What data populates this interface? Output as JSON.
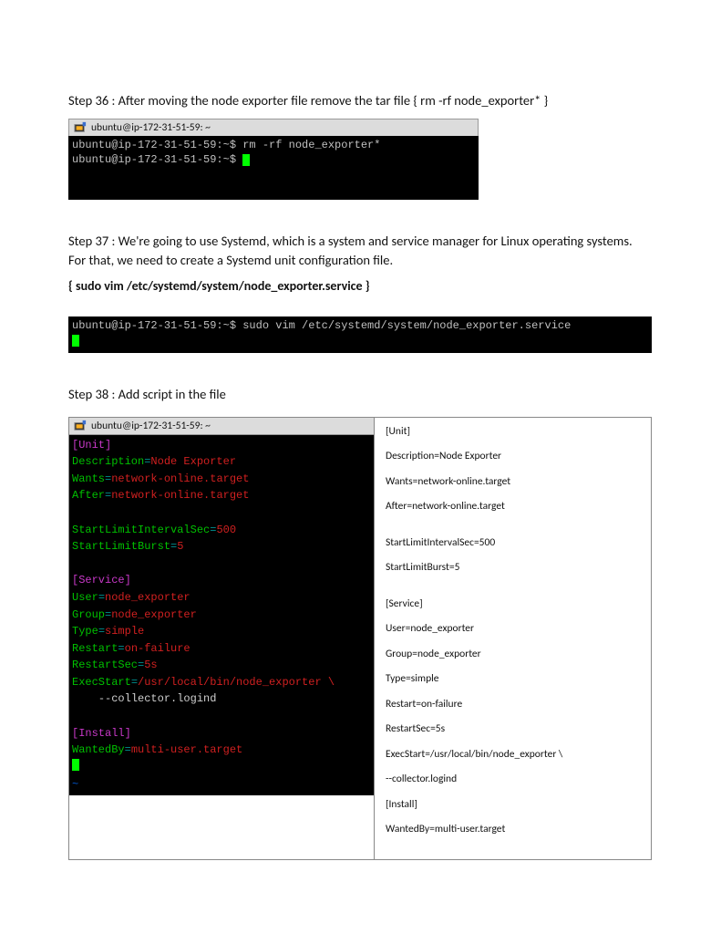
{
  "step36": {
    "heading": "Step 36 : After moving the node exporter file remove the tar file { rm -rf node_exporter* }",
    "titlebar": "ubuntu@ip-172-31-51-59: ~",
    "line1_prompt": "ubuntu@ip-172-31-51-59:~$",
    "line1_cmd": " rm -rf node_exporter*",
    "line2_prompt": "ubuntu@ip-172-31-51-59:~$ "
  },
  "step37": {
    "heading": "Step 37 : We're going to use Systemd, which is a system and service manager for Linux operating systems. For that, we need to create a Systemd unit configuration file.",
    "cmd_bold": "{ sudo vim /etc/systemd/system/node_exporter.service }",
    "term_prompt": "ubuntu@ip-172-31-51-59:~$",
    "term_cmd": " sudo vim /etc/systemd/system/node_exporter.service"
  },
  "step38": {
    "heading": "Step 38 : Add script in the file",
    "titlebar": "ubuntu@ip-172-31-51-59: ~",
    "vim": {
      "unit_hdr": "[Unit]",
      "desc_k": "Description",
      "eq": "=",
      "desc_v": "Node Exporter",
      "wants_k": "Wants",
      "wants_v": "network-online.target",
      "after_k": "After",
      "after_v": "network-online.target",
      "sli_k": "StartLimitIntervalSec",
      "sli_v": "500",
      "slb_k": "StartLimitBurst",
      "slb_v": "5",
      "svc_hdr": "[Service]",
      "user_k": "User",
      "user_v": "node_exporter",
      "group_k": "Group",
      "group_v": "node_exporter",
      "type_k": "Type",
      "type_v": "simple",
      "restart_k": "Restart",
      "restart_v": "on-failure",
      "rsec_k": "RestartSec",
      "rsec_v": "5s",
      "exec_k": "ExecStart",
      "exec_v": "/usr/local/bin/node_exporter \\",
      "exec_cont": "    --collector.logind",
      "inst_hdr": "[Install]",
      "wb_k": "WantedBy",
      "wb_v": "multi-user.target",
      "tilde": "~"
    },
    "plain": {
      "l1": "[Unit]",
      "l2": "Description=Node Exporter",
      "l3": "Wants=network-online.target",
      "l4": "After=network-online.target",
      "l5": "StartLimitIntervalSec=500",
      "l6": "StartLimitBurst=5",
      "l7": "[Service]",
      "l8": "User=node_exporter",
      "l9": "Group=node_exporter",
      "l10": "Type=simple",
      "l11": "Restart=on-failure",
      "l12": "RestartSec=5s",
      "l13": "ExecStart=/usr/local/bin/node_exporter \\",
      "l14": "  --collector.logind",
      "l15": "[Install]",
      "l16": "WantedBy=multi-user.target"
    }
  }
}
